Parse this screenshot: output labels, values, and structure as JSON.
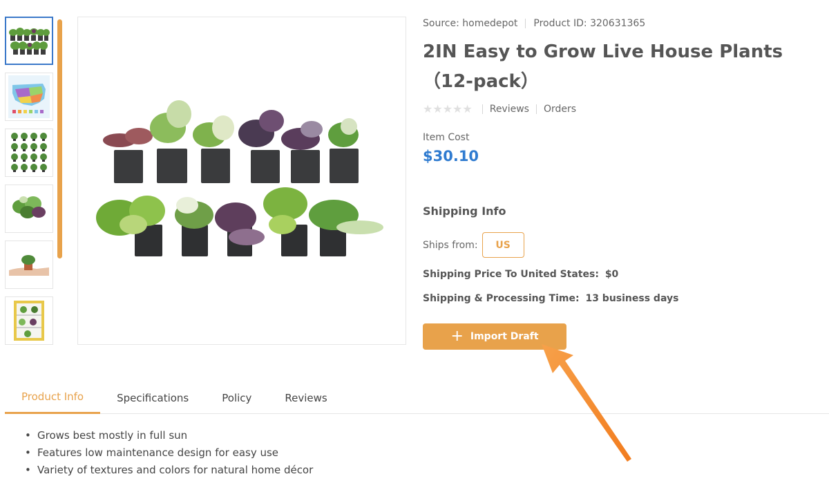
{
  "thumbnails": [
    {
      "name": "plants-front-thumb",
      "active": true
    },
    {
      "name": "hardiness-map-thumb",
      "active": false
    },
    {
      "name": "plant-grid-thumb",
      "active": false
    },
    {
      "name": "plant-cluster-thumb",
      "active": false
    },
    {
      "name": "plant-in-hand-thumb",
      "active": false
    },
    {
      "name": "plant-shelf-thumb",
      "active": false
    }
  ],
  "meta": {
    "source": "Source: homedepot",
    "product_id": "Product ID: 320631365"
  },
  "product": {
    "title": "2IN Easy to Grow Live House Plants（12-pack）",
    "stars": "★★★★★",
    "reviews_link": "Reviews",
    "orders_link": "Orders",
    "cost_label": "Item Cost",
    "cost_value": "$30.10"
  },
  "shipping": {
    "heading": "Shipping Info",
    "ships_from_label": "Ships from:",
    "ships_from_value": "US",
    "price_label": "Shipping Price To United States:",
    "price_value": "$0",
    "time_label": "Shipping & Processing Time:",
    "time_value": "13 business days"
  },
  "actions": {
    "import_icon": "+",
    "import_label": "Import Draft"
  },
  "tabs": [
    {
      "label": "Product Info",
      "active": true
    },
    {
      "label": "Specifications",
      "active": false
    },
    {
      "label": "Policy",
      "active": false
    },
    {
      "label": "Reviews",
      "active": false
    }
  ],
  "bullets": [
    "Grows best mostly in full sun",
    "Features low maintenance design for easy use",
    "Variety of textures and colors for natural home décor"
  ],
  "colors": {
    "accent": "#e8a24b",
    "price": "#2f7bd0",
    "active_thumb_border": "#3a78c9",
    "arrow": "#f5892a"
  }
}
